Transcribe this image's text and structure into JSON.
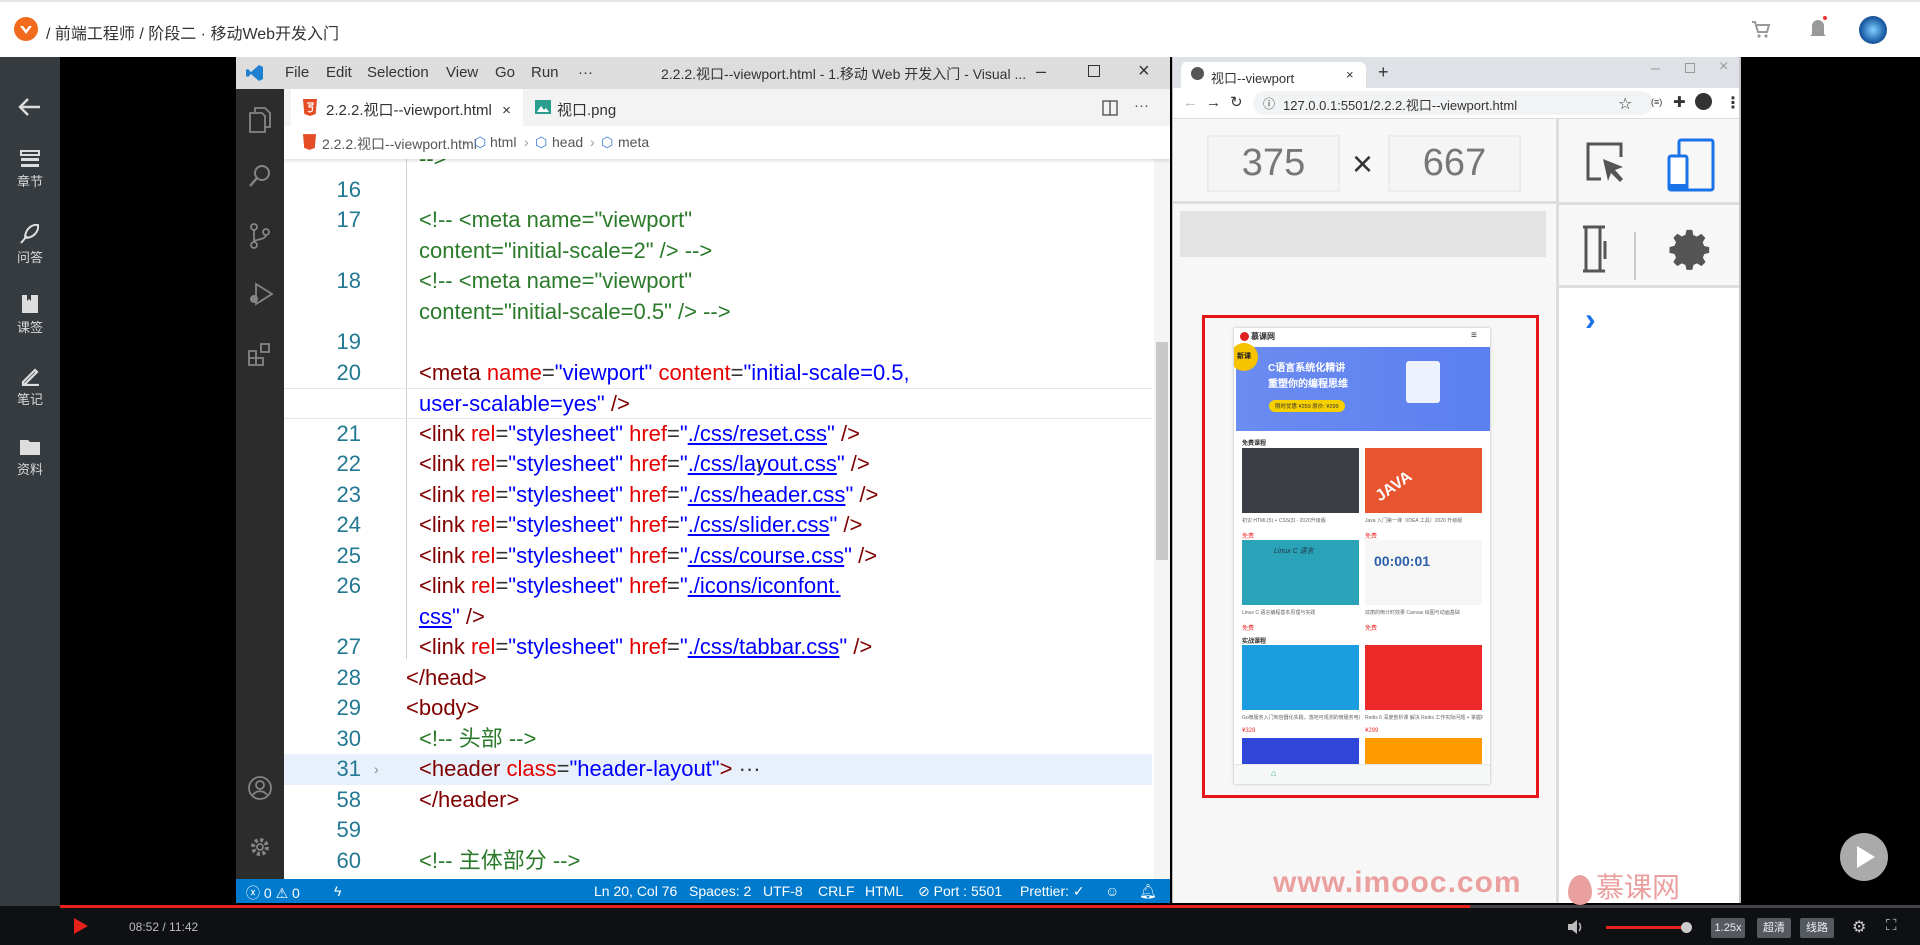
{
  "topbar": {
    "breadcrumb": "/  前端工程师  /  阶段二 · 移动Web开发入门"
  },
  "sidebar": {
    "items": [
      {
        "label": "章节",
        "icon": "list-icon"
      },
      {
        "label": "问答",
        "icon": "feather-icon"
      },
      {
        "label": "课签",
        "icon": "bookmark-icon"
      },
      {
        "label": "笔记",
        "icon": "pen-icon"
      },
      {
        "label": "资料",
        "icon": "folder-icon"
      }
    ]
  },
  "vscode": {
    "menu": [
      "File",
      "Edit",
      "Selection",
      "View",
      "Go",
      "Run",
      "···"
    ],
    "title": "2.2.2.视口--viewport.html - 1.移动 Web 开发入门 - Visual ...",
    "tabs": [
      {
        "label": "2.2.2.视口--viewport.html",
        "close": "×"
      },
      {
        "label": "视口.png"
      }
    ],
    "breadcrumb": [
      "2.2.2.视口--viewport.html",
      "html",
      "head",
      "meta"
    ],
    "code": [
      {
        "n": "",
        "t": [
          [
            "cm",
            "-->"
          ]
        ]
      },
      {
        "n": "16",
        "t": []
      },
      {
        "n": "17",
        "t": [
          [
            "cm",
            "<!-- <meta name=\"viewport\""
          ]
        ]
      },
      {
        "n": "",
        "t": [
          [
            "cm",
            "content=\"initial-scale=2\" /> -->"
          ]
        ]
      },
      {
        "n": "18",
        "t": [
          [
            "cm",
            "<!-- <meta name=\"viewport\""
          ]
        ]
      },
      {
        "n": "",
        "t": [
          [
            "cm",
            "content=\"initial-scale=0.5\" /> -->"
          ]
        ]
      },
      {
        "n": "19",
        "t": []
      },
      {
        "n": "20",
        "t": [
          [
            "tg",
            "<meta "
          ],
          [
            "at",
            "name"
          ],
          [
            "eq",
            "="
          ],
          [
            "st",
            "\"viewport\" "
          ],
          [
            "at",
            "content"
          ],
          [
            "eq",
            "="
          ],
          [
            "st",
            "\"initial-scale=0.5,"
          ]
        ]
      },
      {
        "n": "",
        "t": [
          [
            "st",
            "user-scalable=yes\" "
          ],
          [
            "tg",
            "/>"
          ]
        ]
      },
      {
        "n": "21",
        "t": [
          [
            "tg",
            "<link "
          ],
          [
            "at",
            "rel"
          ],
          [
            "eq",
            "="
          ],
          [
            "st",
            "\"stylesheet\" "
          ],
          [
            "at",
            "href"
          ],
          [
            "eq",
            "="
          ],
          [
            "st",
            "\""
          ],
          [
            "lk",
            "./css/reset.css"
          ],
          [
            "st",
            "\" "
          ],
          [
            "tg",
            "/>"
          ]
        ]
      },
      {
        "n": "22",
        "t": [
          [
            "tg",
            "<link "
          ],
          [
            "at",
            "rel"
          ],
          [
            "eq",
            "="
          ],
          [
            "st",
            "\"stylesheet\" "
          ],
          [
            "at",
            "href"
          ],
          [
            "eq",
            "="
          ],
          [
            "st",
            "\""
          ],
          [
            "lk",
            "./css/layout.css"
          ],
          [
            "st",
            "\" "
          ],
          [
            "tg",
            "/>"
          ]
        ]
      },
      {
        "n": "23",
        "t": [
          [
            "tg",
            "<link "
          ],
          [
            "at",
            "rel"
          ],
          [
            "eq",
            "="
          ],
          [
            "st",
            "\"stylesheet\" "
          ],
          [
            "at",
            "href"
          ],
          [
            "eq",
            "="
          ],
          [
            "st",
            "\""
          ],
          [
            "lk",
            "./css/header.css"
          ],
          [
            "st",
            "\" "
          ],
          [
            "tg",
            "/>"
          ]
        ]
      },
      {
        "n": "24",
        "t": [
          [
            "tg",
            "<link "
          ],
          [
            "at",
            "rel"
          ],
          [
            "eq",
            "="
          ],
          [
            "st",
            "\"stylesheet\" "
          ],
          [
            "at",
            "href"
          ],
          [
            "eq",
            "="
          ],
          [
            "st",
            "\""
          ],
          [
            "lk",
            "./css/slider.css"
          ],
          [
            "st",
            "\" "
          ],
          [
            "tg",
            "/>"
          ]
        ]
      },
      {
        "n": "25",
        "t": [
          [
            "tg",
            "<link "
          ],
          [
            "at",
            "rel"
          ],
          [
            "eq",
            "="
          ],
          [
            "st",
            "\"stylesheet\" "
          ],
          [
            "at",
            "href"
          ],
          [
            "eq",
            "="
          ],
          [
            "st",
            "\""
          ],
          [
            "lk",
            "./css/course.css"
          ],
          [
            "st",
            "\" "
          ],
          [
            "tg",
            "/>"
          ]
        ]
      },
      {
        "n": "26",
        "t": [
          [
            "tg",
            "<link "
          ],
          [
            "at",
            "rel"
          ],
          [
            "eq",
            "="
          ],
          [
            "st",
            "\"stylesheet\" "
          ],
          [
            "at",
            "href"
          ],
          [
            "eq",
            "="
          ],
          [
            "st",
            "\""
          ],
          [
            "lk",
            "./icons/iconfont."
          ]
        ]
      },
      {
        "n": "",
        "t": [
          [
            "lk",
            "css"
          ],
          [
            "st",
            "\" "
          ],
          [
            "tg",
            "/>"
          ]
        ]
      },
      {
        "n": "27",
        "t": [
          [
            "tg",
            "<link "
          ],
          [
            "at",
            "rel"
          ],
          [
            "eq",
            "="
          ],
          [
            "st",
            "\"stylesheet\" "
          ],
          [
            "at",
            "href"
          ],
          [
            "eq",
            "="
          ],
          [
            "st",
            "\""
          ],
          [
            "lk",
            "./css/tabbar.css"
          ],
          [
            "st",
            "\" "
          ],
          [
            "tg",
            "/>"
          ]
        ]
      },
      {
        "n": "28",
        "t": [
          [
            "tg",
            "</head>"
          ]
        ],
        "o": true
      },
      {
        "n": "29",
        "t": [
          [
            "tg",
            "<body>"
          ]
        ],
        "o": true
      },
      {
        "n": "30",
        "t": [
          [
            "cm",
            "<!-- 头部 -->"
          ]
        ]
      },
      {
        "n": "31",
        "t": [
          [
            "tg",
            "<header "
          ],
          [
            "at",
            "class"
          ],
          [
            "eq",
            "="
          ],
          [
            "st",
            "\"header-layout\""
          ],
          [
            "tg",
            ">"
          ],
          [
            "tx",
            " ···"
          ]
        ],
        "hl": true
      },
      {
        "n": "58",
        "t": [
          [
            "tg",
            "</header>"
          ]
        ]
      },
      {
        "n": "59",
        "t": []
      },
      {
        "n": "60",
        "t": [
          [
            "cm",
            "<!-- 主体部分 -->"
          ]
        ]
      }
    ],
    "status": {
      "problems": "ⓧ 0 ⚠ 0",
      "position": "Ln 20, Col 76",
      "spaces": "Spaces: 2",
      "encoding": "UTF-8",
      "eol": "CRLF",
      "language": "HTML",
      "port": "⊘ Port : 5501",
      "prettier": "Prettier: ✓"
    }
  },
  "browser": {
    "tab_title": "视口--viewport",
    "tab_close": "×",
    "new_tab": "+",
    "url": "127.0.0.1:5501/2.2.2.视口--viewport.html",
    "width": "375",
    "height": "667",
    "times": "×"
  },
  "phone": {
    "logo": "慕课网",
    "banner_badge": "新课",
    "banner_line1": "C语言系统化精讲",
    "banner_line2": "重塑你的编程思维",
    "banner_offer": "限时优惠 ¥259 原价: ¥299",
    "section_free": "免费课程",
    "section_paid": "实战课程",
    "courses": [
      {
        "caption": "初识 HTML(5) + CSS(3) - 2020升级版",
        "price": "免费",
        "color": "#3b3f45"
      },
      {
        "caption": "Java 入门第一课（IDEA 工具）2020 升级版",
        "price": "免费",
        "color": "#e8542d"
      },
      {
        "caption": "Linux C 语言编程基本原理与实践",
        "price": "免费",
        "color": "#2aa3b8"
      },
      {
        "caption": "炫丽的倒计时效果 Canvas 绘图与动画基础",
        "price": "免费",
        "color": "#f6f6f6"
      },
      {
        "caption": "Go微服务入门到容器化实践，落地可观测的微服务电商项目",
        "price": "¥328",
        "color": "#1a9ee0"
      },
      {
        "caption": "Redis 6 深度剖析课 解决 Redis 工作实际问题 + 掌握Redis 6 新性",
        "price": "¥299",
        "color": "#ec2a2a"
      }
    ],
    "java_text": "JAVA",
    "timer_text": "00:00:01",
    "linux_text": "Linux C 语言"
  },
  "watermark": {
    "site": "www.imooc.com",
    "brand": "慕课网"
  },
  "player": {
    "time": "08:52 / 11:42",
    "progress": 0.758,
    "volume": 1.0,
    "speed": "1.25x",
    "quality": "超清",
    "route": "线路"
  },
  "colors": {
    "accent_red": "#e8221b",
    "vscode_blue": "#007acc",
    "device_blue": "#1a73e8"
  }
}
